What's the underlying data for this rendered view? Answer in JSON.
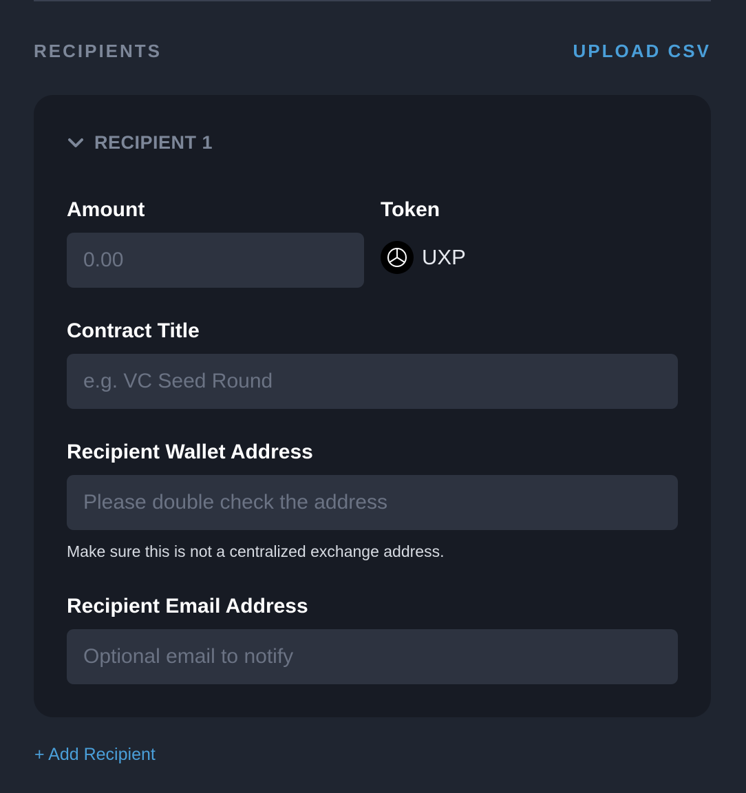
{
  "section": {
    "title": "RECIPIENTS",
    "upload_label": "UPLOAD CSV"
  },
  "recipient": {
    "toggle_label": "RECIPIENT 1",
    "amount": {
      "label": "Amount",
      "value": "",
      "placeholder": "0.00"
    },
    "token": {
      "label": "Token",
      "symbol": "UXP",
      "icon": "uxp-token-icon"
    },
    "contract_title": {
      "label": "Contract Title",
      "value": "",
      "placeholder": "e.g. VC Seed Round"
    },
    "wallet": {
      "label": "Recipient Wallet Address",
      "value": "",
      "placeholder": "Please double check the address",
      "hint": "Make sure this is not a centralized exchange address."
    },
    "email": {
      "label": "Recipient Email Address",
      "value": "",
      "placeholder": "Optional email to notify"
    }
  },
  "add_recipient_label": "+ Add Recipient",
  "colors": {
    "background": "#1f2530",
    "card": "#171b24",
    "input": "#2d3340",
    "accent": "#4a9fd9",
    "muted": "#7d8799"
  }
}
